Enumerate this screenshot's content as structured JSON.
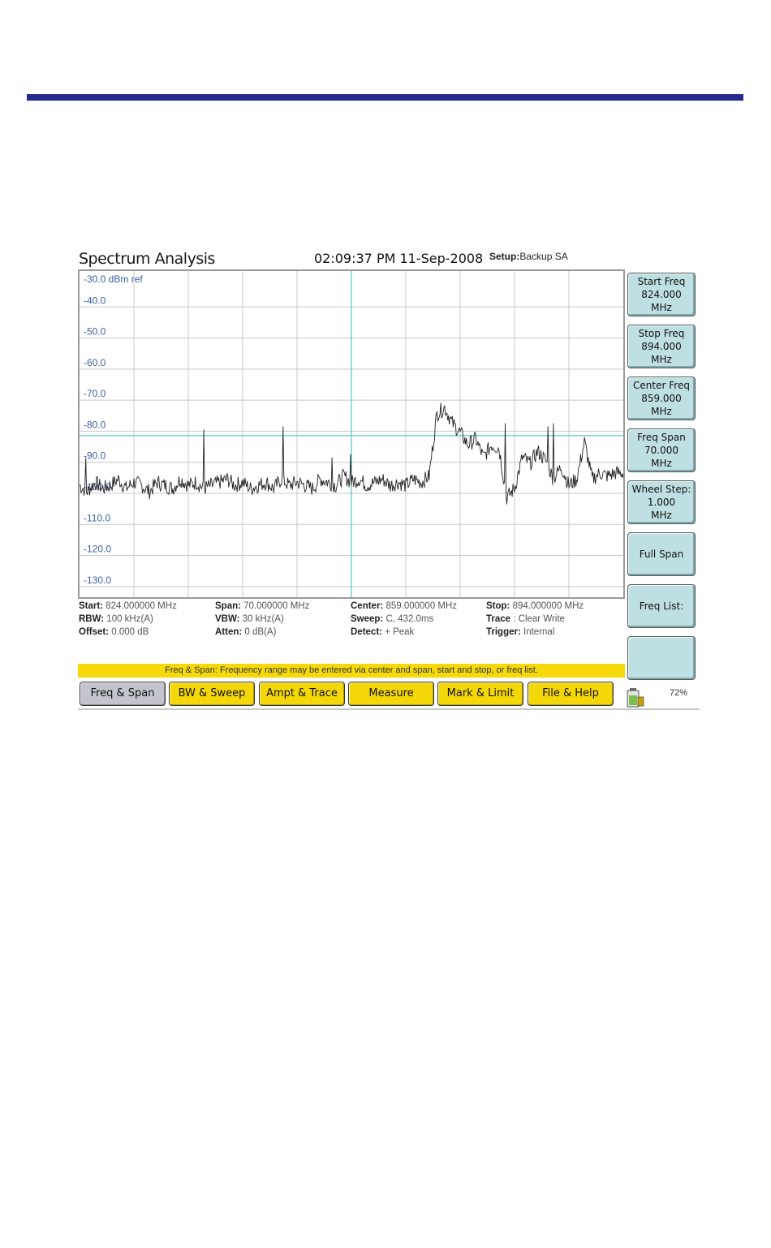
{
  "header": {
    "title": "Spectrum Analysis",
    "datetime": "02:09:37 PM 11-Sep-2008",
    "setup_label": "Setup:",
    "setup_value": "Backup SA"
  },
  "chart_data": {
    "type": "line",
    "ref_label": "-30.0 dBm ref",
    "y_tick_labels": [
      "-40.0",
      "-50.0",
      "-60.0",
      "-70.0",
      "-80.0",
      "-90.0",
      "-100.0",
      "-110.0",
      "-120.0",
      "-130.0"
    ],
    "ylim": [
      -135,
      -30
    ],
    "xlim": [
      824,
      894
    ],
    "x_unit": "MHz",
    "y_unit": "dBm",
    "grid": true,
    "center_marker_mhz": 859,
    "ref_line_dbm": -83,
    "trace": {
      "x": [
        824,
        825,
        826,
        827,
        828,
        829,
        830,
        831,
        832,
        833,
        834,
        835,
        836,
        837,
        838,
        839,
        840,
        841,
        842,
        843,
        844,
        845,
        846,
        847,
        848,
        849,
        850,
        851,
        852,
        853,
        854,
        855,
        856,
        857,
        858,
        859,
        860,
        861,
        862,
        863,
        864,
        865,
        866,
        867,
        868,
        869,
        870,
        871,
        872,
        873,
        874,
        875,
        876,
        877,
        878,
        879,
        880,
        881,
        882,
        883,
        884,
        885,
        886,
        887,
        888,
        889,
        890,
        891,
        892,
        893,
        894
      ],
      "y": [
        -99,
        -101,
        -98,
        -100,
        -99,
        -97,
        -100,
        -98,
        -99,
        -101,
        -98,
        -99,
        -100,
        -97,
        -99,
        -98,
        -100,
        -99,
        -98,
        -97,
        -99,
        -98,
        -100,
        -99,
        -98,
        -100,
        -97,
        -99,
        -98,
        -99,
        -100,
        -97,
        -98,
        -99,
        -96,
        -98,
        -97,
        -99,
        -98,
        -97,
        -99,
        -98,
        -99,
        -97,
        -98,
        -96,
        -76,
        -74,
        -79,
        -82,
        -86,
        -84,
        -90,
        -86,
        -87,
        -103,
        -100,
        -90,
        -92,
        -88,
        -91,
        -97,
        -93,
        -99,
        -97,
        -85,
        -97,
        -95,
        -96,
        -95,
        -95
      ]
    },
    "spikes": [
      {
        "x": 824.8,
        "y": -90
      },
      {
        "x": 840,
        "y": -81
      },
      {
        "x": 850.2,
        "y": -80
      },
      {
        "x": 856.5,
        "y": -90
      },
      {
        "x": 858.9,
        "y": -89
      },
      {
        "x": 878.8,
        "y": -79
      },
      {
        "x": 884.3,
        "y": -80
      },
      {
        "x": 885,
        "y": -79
      }
    ]
  },
  "params": {
    "col1": [
      {
        "label": "Start:",
        "value": "824.000000 MHz"
      },
      {
        "label": "RBW:",
        "value": "100 kHz(A)"
      },
      {
        "label": "Offset:",
        "value": "0.000 dB"
      }
    ],
    "col2": [
      {
        "label": "Span:",
        "value": "70.000000 MHz"
      },
      {
        "label": "VBW:",
        "value": "30 kHz(A)"
      },
      {
        "label": "Atten:",
        "value": "0 dB(A)"
      }
    ],
    "col3": [
      {
        "label": "Center:",
        "value": "859.000000 MHz"
      },
      {
        "label": "Sweep:",
        "value": "C, 432.0ms"
      },
      {
        "label": "Detect:",
        "value": "+ Peak"
      }
    ],
    "col4": [
      {
        "label": "Stop:",
        "value": "894.000000 MHz"
      },
      {
        "label": "Trace",
        "value": ": Clear Write"
      },
      {
        "label": "Trigger:",
        "value": "Internal"
      }
    ]
  },
  "status_message": "Freq & Span: Frequency range may be entered via center and span, start and stop, or freq list.",
  "tabs": [
    "Freq & Span",
    "BW & Sweep",
    "Ampt &  Trace",
    "Measure",
    "Mark & Limit",
    "File & Help"
  ],
  "active_tab": 0,
  "softkeys": [
    {
      "line1": "Start Freq",
      "line2": "824.000",
      "line3": "MHz"
    },
    {
      "line1": "Stop Freq",
      "line2": "894.000",
      "line3": "MHz"
    },
    {
      "line1": "Center Freq",
      "line2": "859.000",
      "line3": "MHz"
    },
    {
      "line1": "Freq Span",
      "line2": "70.000",
      "line3": "MHz"
    },
    {
      "line1": "Wheel Step:",
      "line2": "1.000",
      "line3": "MHz"
    },
    {
      "line1": "Full Span",
      "line2": "",
      "line3": ""
    },
    {
      "line1": "Freq List:",
      "line2": "",
      "line3": ""
    },
    {
      "line1": "",
      "line2": "",
      "line3": ""
    }
  ],
  "battery_percent": "72%",
  "colors": {
    "header_rule": "#262a8c",
    "trace": "#222222",
    "marker": "#4fc3c0",
    "grid": "#c8c8c8",
    "axis_text": "#3a5fa8",
    "status_bar": "#f5d90a",
    "tab": "#f4d708",
    "tab_active": "#c4c4cc",
    "softkey": "#bfe0e2"
  }
}
